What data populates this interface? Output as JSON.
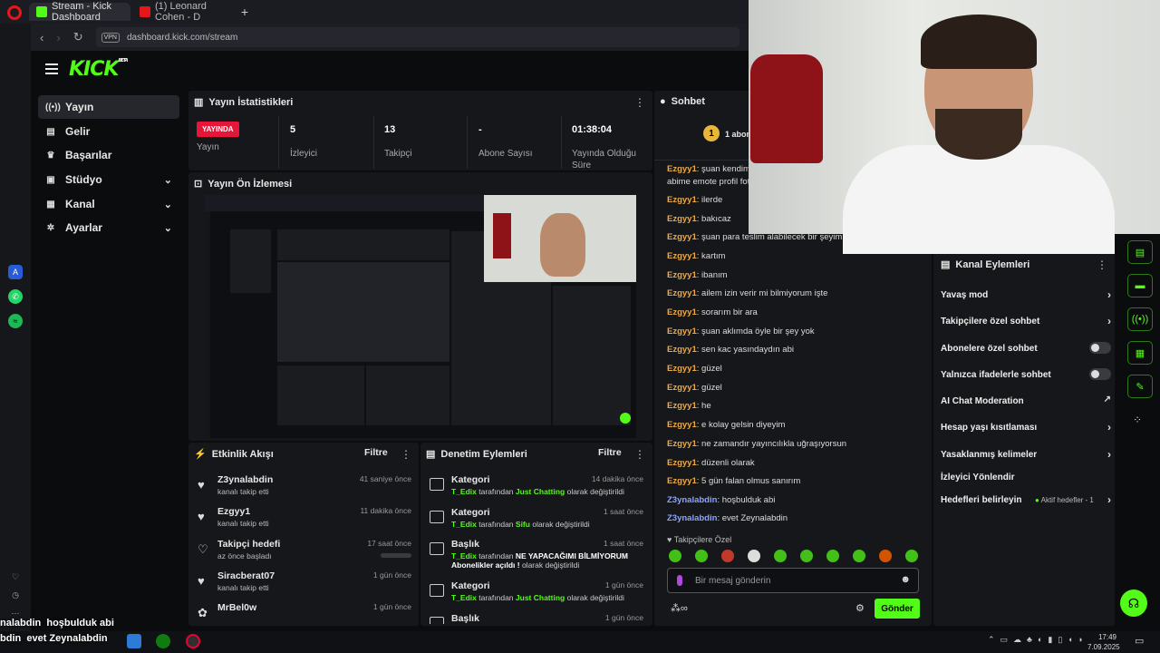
{
  "browser": {
    "tabs": [
      {
        "label": "Stream - Kick Dashboard"
      },
      {
        "label": "(1) Leonard Cohen - D"
      }
    ],
    "url": "dashboard.kick.com/stream",
    "vpn": "VPN"
  },
  "kick": {
    "logo": "KICK",
    "beta": "BETA"
  },
  "nav": [
    {
      "label": "Yayın",
      "icon": "broadcast-icon"
    },
    {
      "label": "Gelir",
      "icon": "money-icon"
    },
    {
      "label": "Başarılar",
      "icon": "trophy-icon"
    },
    {
      "label": "Stüdyo",
      "icon": "studio-icon"
    },
    {
      "label": "Kanal",
      "icon": "channel-icon"
    },
    {
      "label": "Ayarlar",
      "icon": "gear-icon"
    }
  ],
  "stats": {
    "title": "Yayın İstatistikleri",
    "live_badge": "YAYINDA",
    "items": [
      {
        "value": "",
        "label": "Yayın"
      },
      {
        "value": "5",
        "label": "İzleyici"
      },
      {
        "value": "13",
        "label": "Takipçi"
      },
      {
        "value": "-",
        "label": "Abone Sayısı"
      },
      {
        "value": "01:38:04",
        "label": "Yayında Olduğu Süre"
      }
    ]
  },
  "preview": {
    "title": "Yayın Ön İzlemesi"
  },
  "feed": {
    "title": "Etkinlik Akışı",
    "filter": "Filtre",
    "items": [
      {
        "name": "Z3ynalabdin",
        "sub": "kanalı takip etti",
        "time": "41 saniye önce"
      },
      {
        "name": "Ezgyy1",
        "sub": "kanalı takip etti",
        "time": "11 dakika önce"
      },
      {
        "name": "Takipçi hedefi",
        "sub": "az önce başladı",
        "time": "17 saat önce"
      },
      {
        "name": "Siracberat07",
        "sub": "kanalı takip etti",
        "time": "1 gün önce"
      },
      {
        "name": "MrBel0w",
        "sub": "",
        "time": "1 gün önce"
      }
    ]
  },
  "moderation": {
    "title": "Denetim Eylemleri",
    "filter": "Filtre",
    "items": [
      {
        "name": "Kategori",
        "user": "T_Edix",
        "mid": "tarafından",
        "highlight": "Just Chatting",
        "end": "olarak değiştirildi",
        "time": "14 dakika önce"
      },
      {
        "name": "Kategori",
        "user": "T_Edix",
        "mid": "tarafından",
        "highlight": "Sifu",
        "end": "olarak değiştirildi",
        "time": "1 saat önce"
      },
      {
        "name": "Başlık",
        "user": "T_Edix",
        "mid": "tarafından",
        "highlight": "NE YAPACAĞIMI BİLMİYORUM Abonelikler açıldı !",
        "end": "olarak değiştirildi",
        "time": "1 saat önce"
      },
      {
        "name": "Kategori",
        "user": "T_Edix",
        "mid": "tarafından",
        "highlight": "Just Chatting",
        "end": "olarak değiştirildi",
        "time": "1 gün önce"
      },
      {
        "name": "Başlık",
        "user": "",
        "mid": "",
        "highlight": "",
        "end": "",
        "time": "1 gün önce"
      }
    ]
  },
  "chat": {
    "title": "Sohbet",
    "sub_badge": "1",
    "sub_text": "1 abon",
    "messages": [
      {
        "user": "Ezgyy1",
        "text": "şuan kendime"
      },
      {
        "user": "",
        "text": "abime emote profil fot"
      },
      {
        "user": "Ezgyy1",
        "text": "ilerde"
      },
      {
        "user": "Ezgyy1",
        "text": "bakıcaz"
      },
      {
        "user": "Ezgyy1",
        "text": "şuan para teslim alabilecek bir şeyim yok"
      },
      {
        "user": "Ezgyy1",
        "text": "kartım"
      },
      {
        "user": "Ezgyy1",
        "text": "ibanım"
      },
      {
        "user": "Ezgyy1",
        "text": "ailem izin verir mi bilmiyorum işte"
      },
      {
        "user": "Ezgyy1",
        "text": "sorarım bir ara"
      },
      {
        "user": "Ezgyy1",
        "text": "şuan aklımda öyle bir şey yok"
      },
      {
        "user": "Ezgyy1",
        "text": "sen kac yasındaydın abi"
      },
      {
        "user": "Ezgyy1",
        "text": "güzel"
      },
      {
        "user": "Ezgyy1",
        "text": "güzel"
      },
      {
        "user": "Ezgyy1",
        "text": "he"
      },
      {
        "user": "Ezgyy1",
        "text": "e kolay gelsin diyeyim"
      },
      {
        "user": "Ezgyy1",
        "text": "ne zamandır yayıncılıkla uğraşıyorsun"
      },
      {
        "user": "Ezgyy1",
        "text": "düzenli olarak"
      },
      {
        "user": "Ezgyy1",
        "text": "5 gün falan olmus sanırım"
      },
      {
        "user": "Z3ynalabdin",
        "text": "hoşbulduk abi"
      },
      {
        "user": "Z3ynalabdin",
        "text": "evet Zeynalabdin"
      }
    ],
    "followers_only": "Takipçilere Özel",
    "placeholder": "Bir mesaj gönderin",
    "send": "Gönder"
  },
  "actions": {
    "title": "Kanal Eylemleri",
    "items": [
      {
        "label": "Yavaş mod",
        "kind": "chevron"
      },
      {
        "label": "Takipçilere özel sohbet",
        "kind": "chevron"
      },
      {
        "label": "Abonelere özel sohbet",
        "kind": "toggle"
      },
      {
        "label": "Yalnızca ifadelerle sohbet",
        "kind": "toggle"
      },
      {
        "label": "AI Chat Moderation",
        "kind": "link"
      },
      {
        "label": "Hesap yaşı kısıtlaması",
        "kind": "chevron"
      },
      {
        "label": "Yasaklanmış kelimeler",
        "kind": "chevron"
      },
      {
        "label": "İzleyici Yönlendir",
        "kind": "none"
      },
      {
        "label": "Hedefleri belirleyin",
        "kind": "chevron",
        "extra": "Aktif hedefler - 1"
      }
    ]
  },
  "overlay": {
    "line1_user": "nalabdin",
    "line1_text": "hoşbulduk abi",
    "line2_user": "bdin",
    "line2_text": "evet Zeynalabdin"
  },
  "taskbar": {
    "time": "17:49",
    "date": "7.09.2025"
  },
  "colors": {
    "accent": "#53fc18",
    "live": "#e6163a",
    "chat_user": "#f0a940"
  }
}
